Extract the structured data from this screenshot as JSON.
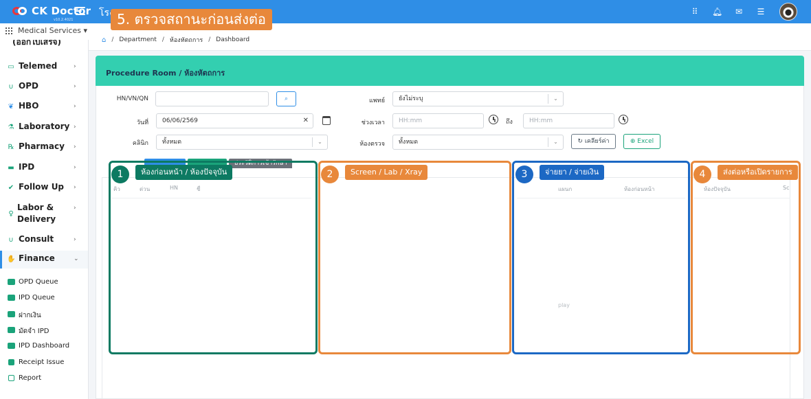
{
  "app": {
    "brand": "CK Doctor",
    "version": "v10.2.4021",
    "hospital_title": "โรง"
  },
  "step_banner": "5. ตรวจสถานะก่อนส่งต่อ",
  "services": {
    "label": "Medical Services ▾"
  },
  "breadcrumb": {
    "items": [
      "Department",
      "ห้องหัตถการ",
      "Dashboard"
    ]
  },
  "sidebar": {
    "cut_item": "(ออกใบเสร็จ)",
    "items": [
      {
        "label": "Telemed",
        "icon": "video-icon"
      },
      {
        "label": "OPD",
        "icon": "stethoscope-icon"
      },
      {
        "label": "HBO",
        "icon": "leaf-icon"
      },
      {
        "label": "Laboratory",
        "icon": "flask-icon"
      },
      {
        "label": "Pharmacy",
        "icon": "pill-icon"
      },
      {
        "label": "IPD",
        "icon": "bed-icon"
      },
      {
        "label": "Follow Up",
        "icon": "user-check-icon"
      },
      {
        "label": "Labor & Delivery",
        "icon": "baby-icon"
      },
      {
        "label": "Consult",
        "icon": "stethoscope-icon"
      },
      {
        "label": "Finance",
        "icon": "money-hand-icon"
      }
    ],
    "sub_items": [
      "OPD Queue",
      "IPD Queue",
      "ฝากเงิน",
      "มัดจำ IPD",
      "IPD Dashboard",
      "Receipt Issue",
      "Report"
    ]
  },
  "card": {
    "title": "Procedure Room / ห้องหัตถการ"
  },
  "form": {
    "hn_label": "HN/VN/QN",
    "hn_value": "",
    "doctor_label": "แพทย์",
    "doctor_value": "ยังไม่ระบุ",
    "date_label": "วันที่",
    "date_value": "06/06/2569",
    "time_label": "ช่วงเวลา",
    "time_from_placeholder": "HH:mm",
    "to_label": "ถึง",
    "time_to_placeholder": "HH:mm",
    "clinic_label": "คลินิก",
    "clinic_value": "ทั้งหมด",
    "room_label": "ห้องตรวจ",
    "room_value": "ทั้งหมด",
    "clear_label": "เคลียร์ค่า",
    "excel_label": "Excel"
  },
  "tabs": {
    "history": "ประวัติการเข้ารักษา"
  },
  "table": {
    "headers": [
      "คิว",
      "ด่วน",
      "HN",
      "ชื่"
    ],
    "col3_headers": [
      "แผนก",
      "ห้องก่อนหน้า"
    ],
    "col4_headers": [
      "ห้องปัจจุบัน",
      "Sc"
    ],
    "faint_text": "play"
  },
  "annotations": [
    {
      "number": "1",
      "label": "ห้องก่อนหน้า / ห้องปัจจุบัน",
      "color": "#0d7a62"
    },
    {
      "number": "2",
      "label": "Screen / Lab / Xray",
      "color": "#e8883b"
    },
    {
      "number": "3",
      "label": "จ่ายยา / จ่ายเงิน",
      "color": "#1c68c4"
    },
    {
      "number": "4",
      "label": "ส่งต่อหรือเปิดรายการ",
      "color": "#e8883b"
    }
  ],
  "colors": {
    "topbar": "#2f8ee6",
    "card_header": "#33cfb0",
    "accent_green": "#1aa37a"
  }
}
